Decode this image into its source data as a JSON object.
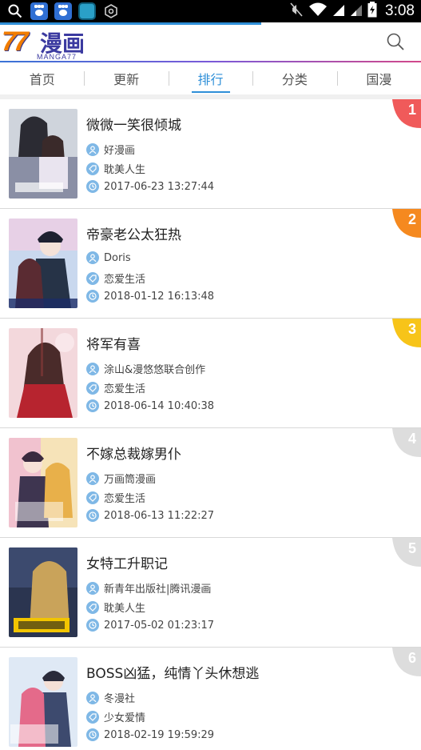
{
  "status_bar": {
    "time": "3:08",
    "icons": [
      "search-icon",
      "baidu-paw-icon",
      "baidu-paw-icon",
      "app-icon",
      "settings-icon",
      "mute-icon",
      "wifi-icon",
      "signal-icon",
      "signal-icon",
      "battery-icon"
    ]
  },
  "header": {
    "logo_number": "77",
    "logo_title": "漫画",
    "logo_subtitle": "MANGA77",
    "search_icon": "search-icon"
  },
  "tabs": [
    {
      "label": "首页",
      "active": false
    },
    {
      "label": "更新",
      "active": false
    },
    {
      "label": "排行",
      "active": true
    },
    {
      "label": "分类",
      "active": false
    },
    {
      "label": "国漫",
      "active": false
    }
  ],
  "colors": {
    "accent": "#2f8fd8",
    "rank_1": "#f05a5a",
    "rank_2": "#f5891f",
    "rank_3": "#f7c419",
    "rank_other": "#dddddd",
    "meta_icon": "#7fb8e6"
  },
  "items": [
    {
      "rank": "1",
      "title": "微微一笑很倾城",
      "author": "好漫画",
      "category": "耽美人生",
      "updated": "2017-06-23 13:27:44"
    },
    {
      "rank": "2",
      "title": "帝豪老公太狂热",
      "author": "Doris",
      "category": "恋爱生活",
      "updated": "2018-01-12 16:13:48"
    },
    {
      "rank": "3",
      "title": "将军有喜",
      "author": "涂山&漫悠悠联合创作",
      "category": "恋爱生活",
      "updated": "2018-06-14 10:40:38"
    },
    {
      "rank": "4",
      "title": "不嫁总裁嫁男仆",
      "author": "万画筒漫画",
      "category": "恋爱生活",
      "updated": "2018-06-13 11:22:27"
    },
    {
      "rank": "5",
      "title": "女特工升职记",
      "author": "新青年出版社|腾讯漫画",
      "category": "耽美人生",
      "updated": "2017-05-02 01:23:17"
    },
    {
      "rank": "6",
      "title": "BOSS凶猛，纯情丫头休想逃",
      "author": "冬漫社",
      "category": "少女爱情",
      "updated": "2018-02-19 19:59:29"
    }
  ]
}
